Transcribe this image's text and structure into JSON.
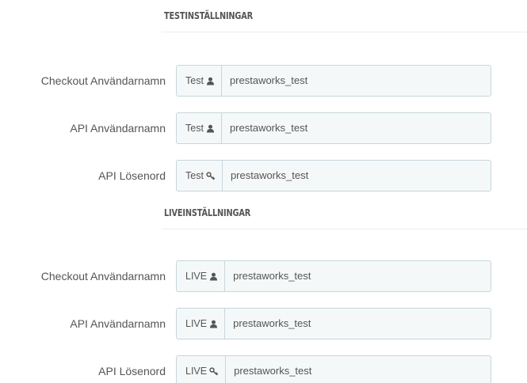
{
  "test_section": {
    "heading": "TESTINSTÄLLNINGAR",
    "rows": [
      {
        "label": "Checkout Användarnamn",
        "addon": "Test",
        "icon": "user-icon",
        "value": "prestaworks_test"
      },
      {
        "label": "API Användarnamn",
        "addon": "Test",
        "icon": "user-icon",
        "value": "prestaworks_test"
      },
      {
        "label": "API Lösenord",
        "addon": "Test",
        "icon": "key-icon",
        "value": "prestaworks_test"
      }
    ]
  },
  "live_section": {
    "heading": "LIVEINSTÄLLNINGAR",
    "rows": [
      {
        "label": "Checkout Användarnamn",
        "addon": "LIVE",
        "icon": "user-icon",
        "value": "prestaworks_test"
      },
      {
        "label": "API Användarnamn",
        "addon": "LIVE",
        "icon": "user-icon",
        "value": "prestaworks_test"
      },
      {
        "label": "API Lösenord",
        "addon": "LIVE",
        "icon": "key-icon",
        "value": "prestaworks_test"
      }
    ]
  },
  "colors": {
    "text": "#555555",
    "input_border": "#c7d6db",
    "input_background": "#f5f8f9",
    "divider": "#eeeeee"
  }
}
